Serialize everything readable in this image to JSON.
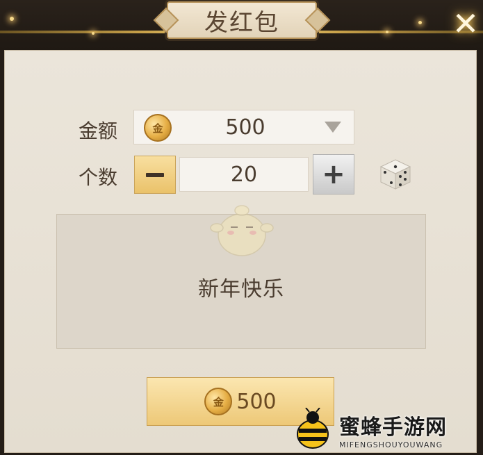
{
  "dialog": {
    "title": "发红包"
  },
  "form": {
    "amount_label": "金额",
    "amount_value": "500",
    "count_label": "个数",
    "count_value": "20"
  },
  "message": {
    "text": "新年快乐"
  },
  "send_button": {
    "value": "500"
  },
  "coin_glyph": "金",
  "icons": {
    "close": "close-icon",
    "dropdown": "chevron-down-icon",
    "minus": "minus-icon",
    "plus": "plus-icon",
    "dice": "dice-icon",
    "coin": "gold-coin-icon"
  },
  "watermark": {
    "main": "蜜蜂手游网",
    "sub": "MIFENGSHOUYOUWANG"
  },
  "colors": {
    "accent_gold": "#eac26a",
    "text_brown": "#4a3c2f",
    "panel_bg": "#ebe5da"
  }
}
